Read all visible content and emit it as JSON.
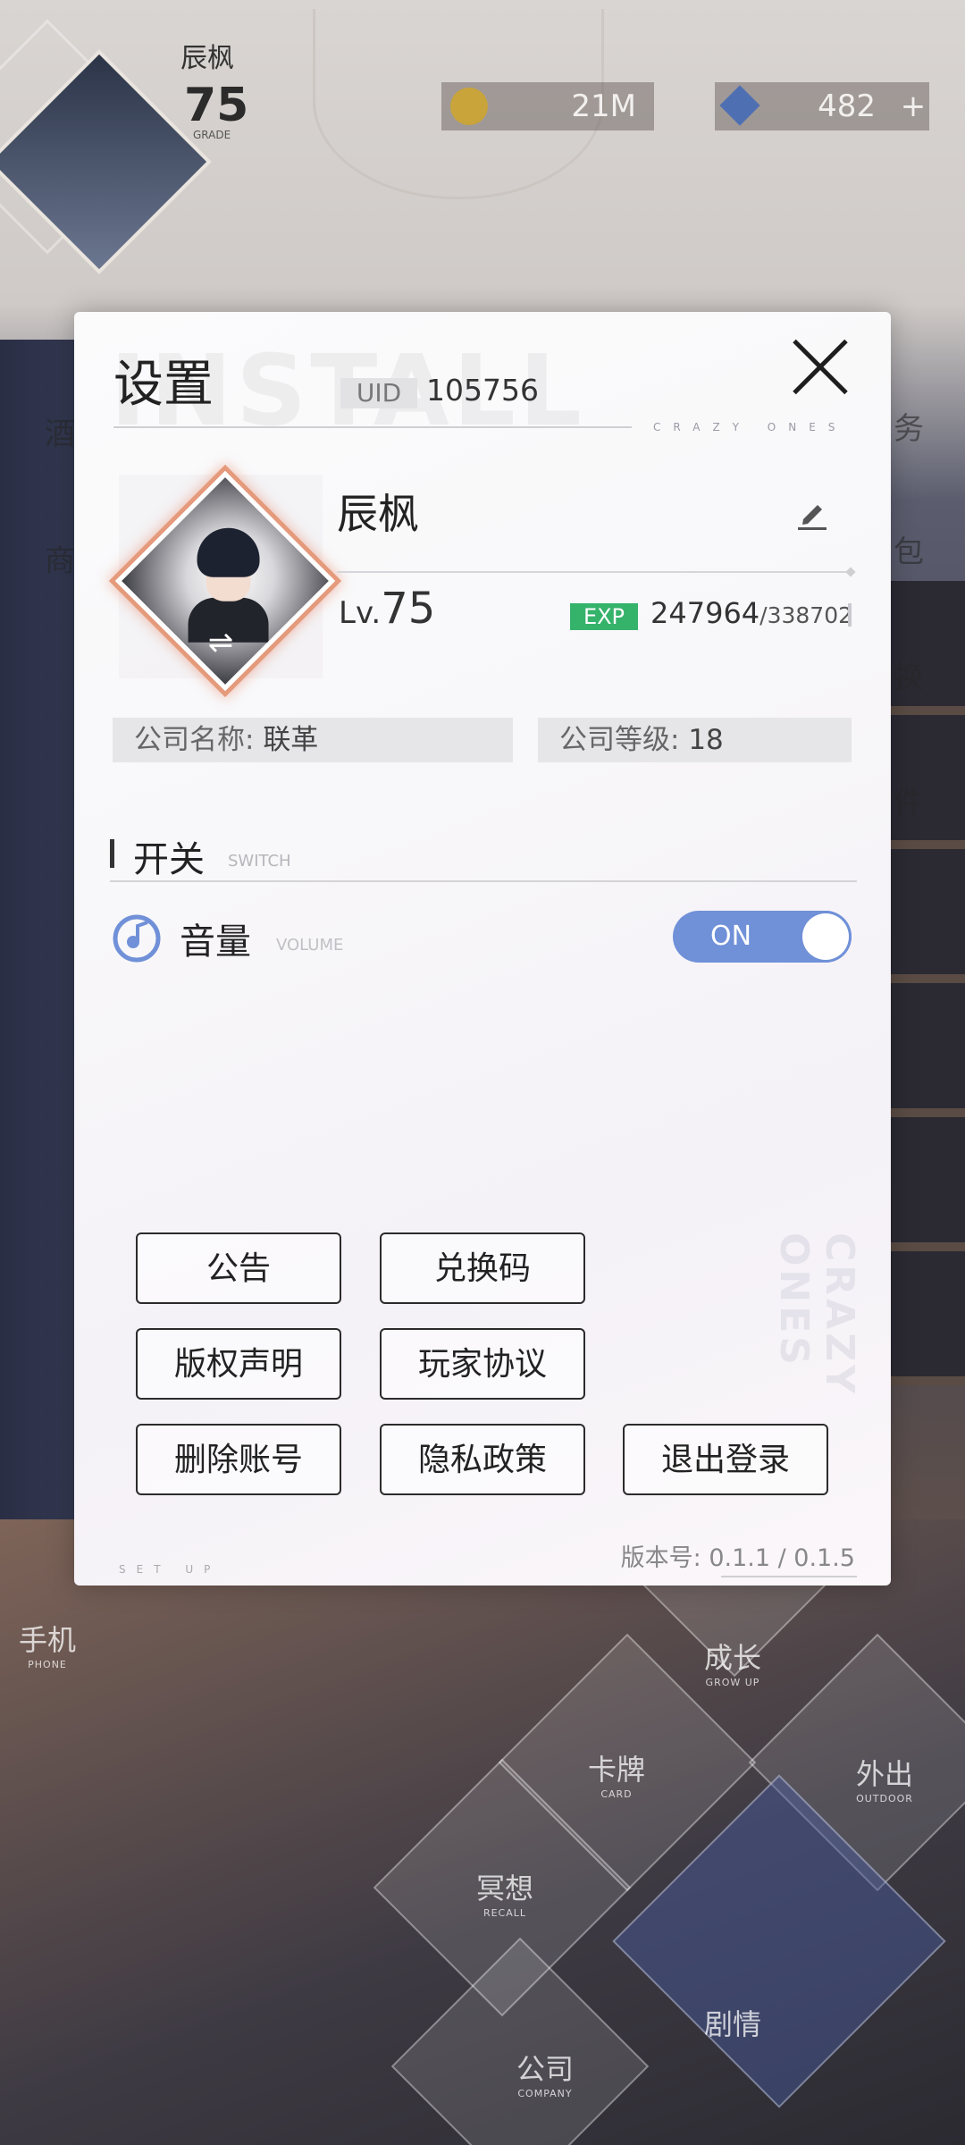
{
  "background": {
    "hud": {
      "name": "辰枫",
      "level": "75",
      "grade_label": "GRADE",
      "coins": "21M",
      "gems": "482",
      "plus": "+"
    },
    "side_labels_left": [
      "酒",
      "商"
    ],
    "side_labels_right": [
      "务",
      "包",
      "换",
      "件"
    ],
    "menu": [
      {
        "cn": "手机",
        "en": "PHONE"
      },
      {
        "cn": "成长",
        "en": "GROW UP"
      },
      {
        "cn": "卡牌",
        "en": "CARD"
      },
      {
        "cn": "外出",
        "en": "OUTDOOR"
      },
      {
        "cn": "冥想",
        "en": "RECALL"
      },
      {
        "cn": "剧情",
        "en": ""
      },
      {
        "cn": "公司",
        "en": "COMPANY"
      }
    ]
  },
  "dialog": {
    "title": "设置",
    "watermark": "INSTALL",
    "uid_label": "UID",
    "uid": "105756",
    "crazy_ones": "CRAZY ONES",
    "profile": {
      "name": "辰枫",
      "lv_prefix": "Lv.",
      "level": "75",
      "exp_label": "EXP",
      "exp_current": "247964",
      "exp_max": "/338702",
      "swap_glyph": "⇌"
    },
    "company_name_label": "公司名称:",
    "company_name": "联革",
    "company_level_label": "公司等级:",
    "company_level": "18",
    "switch_section": {
      "title": "开关",
      "subtitle": "SWITCH"
    },
    "volume": {
      "label": "音量",
      "sublabel": "VOLUME",
      "state": "ON"
    },
    "buttons": {
      "notice": "公告",
      "redeem": "兑换码",
      "copyright": "版权声明",
      "agreement": "玩家协议",
      "delete_account": "删除账号",
      "privacy": "隐私政策",
      "logout": "退出登录"
    },
    "footer": {
      "setup": "SET UP",
      "version_label": "版本号:",
      "version": "0.1.1 / 0.1.5"
    }
  },
  "colors": {
    "toggle": "#7090d8",
    "exp_tag": "#35b36b",
    "avatar_glow": "#e59a7c"
  }
}
